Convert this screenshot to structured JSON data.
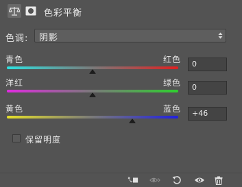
{
  "header": {
    "title": "色彩平衡",
    "icons": [
      "balance-icon",
      "mask-icon"
    ]
  },
  "tone": {
    "label": "色调:",
    "selected": "阴影"
  },
  "sliders": [
    {
      "left": "青色",
      "right": "红色",
      "value": "0",
      "level": 0,
      "color_left": "#2fe0e0",
      "color_right": "#e02020"
    },
    {
      "left": "洋红",
      "right": "绿色",
      "value": "0",
      "level": 0,
      "color_left": "#e02be0",
      "color_right": "#2ed02e"
    },
    {
      "left": "黄色",
      "right": "蓝色",
      "value": "+46",
      "level": 46,
      "color_left": "#e6e02a",
      "color_right": "#2020e0"
    }
  ],
  "preserve_luminosity": {
    "label": "保留明度",
    "checked": false
  },
  "footer": {
    "icons": [
      "clip-to-layer-icon",
      "visibility-toggle-icon",
      "reset-icon",
      "eye-icon",
      "trash-icon"
    ]
  },
  "colors": {
    "panel_bg": "#535353",
    "field_bg": "#444444",
    "text": "#e6e6e6"
  }
}
